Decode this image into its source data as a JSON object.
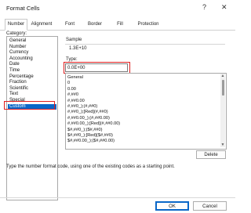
{
  "window": {
    "title": "Format Cells",
    "help_glyph": "?",
    "close_glyph": "✕"
  },
  "tabs": [
    {
      "label": "Number"
    },
    {
      "label": "Alignment"
    },
    {
      "label": "Font"
    },
    {
      "label": "Border"
    },
    {
      "label": "Fill"
    },
    {
      "label": "Protection"
    }
  ],
  "category": {
    "label": "Category:",
    "items": [
      "General",
      "Number",
      "Currency",
      "Accounting",
      "Date",
      "Time",
      "Percentage",
      "Fraction",
      "Scientific",
      "Text",
      "Special",
      "Custom"
    ],
    "selected": "Custom"
  },
  "sample": {
    "label": "Sample",
    "value": "1.3E+10"
  },
  "type": {
    "label": "Type:",
    "value": "0.0E+00"
  },
  "formats": [
    "General",
    "0",
    "0.00",
    "#,##0",
    "#,##0.00",
    "#,##0_);(#,##0)",
    "#,##0_);[Red](#,##0)",
    "#,##0.00_);(#,##0.00)",
    "#,##0.00_);[Red](#,##0.00)",
    "$#,##0_);($#,##0)",
    "$#,##0_);[Red]($#,##0)",
    "$#,##0.00_);($#,##0.00)"
  ],
  "delete_label": "Delete",
  "hint": "Type the number format code, using one of the existing codes as a starting point.",
  "buttons": {
    "ok": "OK",
    "cancel": "Cancel"
  },
  "colors": {
    "accent": "#0a67c8",
    "highlight": "#e01e1e"
  }
}
